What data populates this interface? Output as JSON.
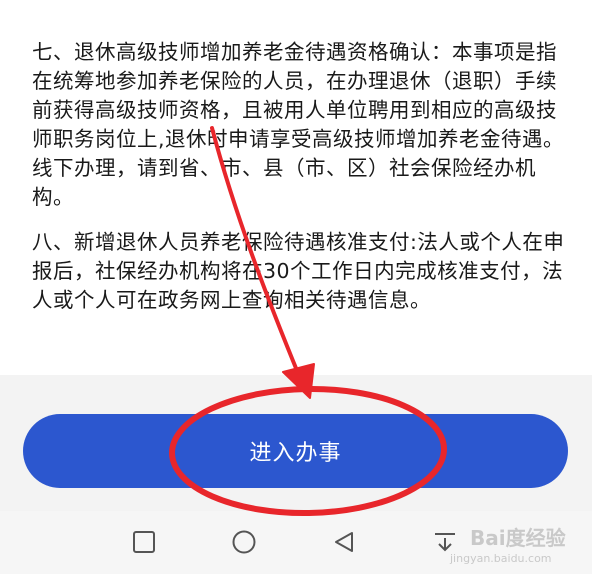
{
  "content": {
    "item7": "七、退休高级技师增加养老金待遇资格确认：本事项是指在统筹地参加养老保险的人员，在办理退休（退职）手续前获得高级技师资格，且被用人单位聘用到相应的高级技师职务岗位上,退休时申请享受高级技师增加养老金待遇。线下办理，请到省、市、县（市、区）社会保险经办机构。",
    "item8": "八、新增退休人员养老保险待遇核准支付:法人或个人在申报后，社保经办机构将在30个工作日内完成核准支付，法人或个人可在政务网上查询相关待遇信息。"
  },
  "button": {
    "label": "进入办事"
  },
  "navbar": {
    "icons": [
      "square-icon",
      "circle-icon",
      "triangle-back-icon",
      "download-icon"
    ]
  },
  "watermark": {
    "logo": "Bai度经验",
    "url": "jingyan.baidu.com"
  },
  "colors": {
    "button": "#2c57cf",
    "annotation": "#e8262b"
  }
}
